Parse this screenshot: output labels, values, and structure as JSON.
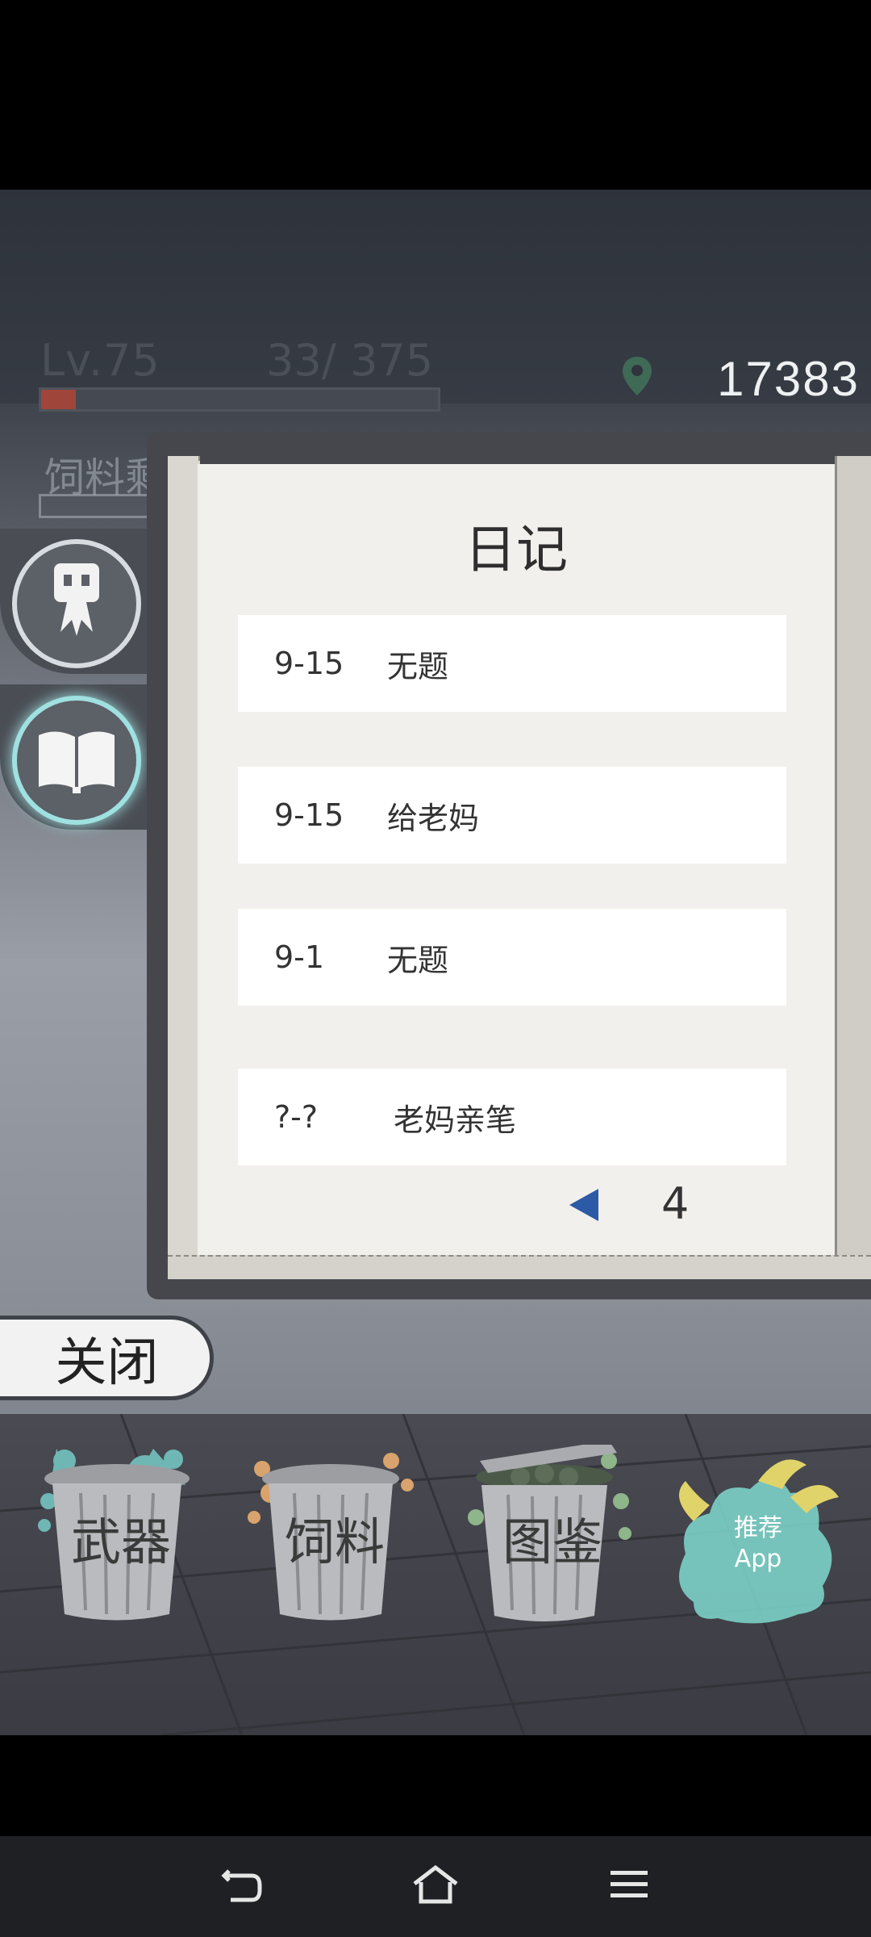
{
  "hud": {
    "level": "Lv.75",
    "exp": "33/  375",
    "exp_fraction": 0.088,
    "coins": "17383",
    "feed_label": "饲料剩"
  },
  "diary": {
    "title": "日记",
    "entries": [
      {
        "date": "9-15",
        "title": "无题"
      },
      {
        "date": "9-15",
        "title": "给老妈"
      },
      {
        "date": "9-1",
        "title": "无题"
      },
      {
        "date": "?-?",
        "title": "老妈亲笔"
      }
    ],
    "page": "4"
  },
  "close_label": "关闭",
  "bins": [
    {
      "label": "武器"
    },
    {
      "label": "饲料"
    },
    {
      "label": "图鉴"
    }
  ],
  "recommend": {
    "line1": "推荐",
    "line2": "App"
  },
  "icons": {
    "side_top": "character-icon",
    "side_bottom": "book-icon",
    "pager": "triangle-left-icon",
    "nav_back": "back-icon",
    "nav_home": "home-icon",
    "nav_menu": "menu-icon"
  },
  "colors": {
    "accent_glow": "#9fe1e0",
    "pager_arrow": "#2d5aa6",
    "page_bg": "#f2f0ec"
  }
}
